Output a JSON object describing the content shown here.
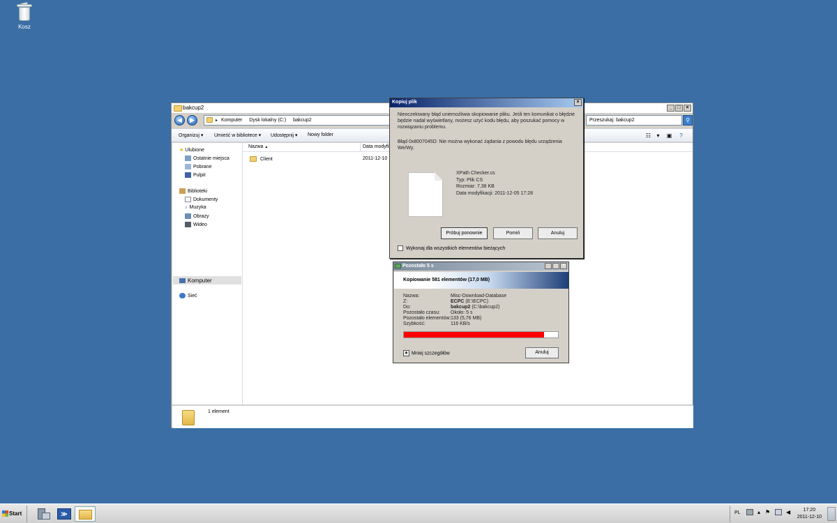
{
  "desktop": {
    "recycle_bin_label": "Kosz",
    "background_color": "#3a6ea5"
  },
  "explorer": {
    "title": "bakcup2",
    "breadcrumb": [
      "Komputer",
      "Dysk lokalny (C:)",
      "bakcup2"
    ],
    "search_placeholder": "Przeszukaj: bakcup2",
    "toolbar": {
      "organize": "Organizuj",
      "include_library": "Umieść w bibliotece",
      "share": "Udostępnij",
      "new_folder": "Nowy folder"
    },
    "nav": {
      "favorites": "Ulubione",
      "recent": "Ostatnie miejsca",
      "downloads": "Pobrane",
      "desktop": "Pulpit",
      "libraries": "Biblioteki",
      "documents": "Dokumenty",
      "music": "Muzyka",
      "pictures": "Obrazy",
      "videos": "Wideo",
      "computer": "Komputer",
      "network": "Sieć"
    },
    "columns": {
      "name": "Nazwa",
      "date": "Data modyfik"
    },
    "rows": [
      {
        "name": "Client",
        "date": "2011-12-10"
      }
    ],
    "status": "1 element"
  },
  "error_dialog": {
    "title": "Kopiuj plik",
    "message": "Nieoczekiwany błąd uniemożliwia skopiowanie pliku. Jeśli ten komunikat o błędzie będzie nadal wyświetlany, możesz użyć kodu błędu, aby poszukać pomocy w rozwiązaniu problemu.",
    "error_text": "Błąd 0x8007045D: Nie można wykonać żądania z powodu błędu urządzenia We/Wy.",
    "file": {
      "name": "XPath Checker.cs",
      "type": "Typ: Plik CS",
      "size": "Rozmiar: 7,38 KB",
      "modified": "Data modyfikacji: 2011-12-05 17:28"
    },
    "buttons": {
      "retry": "Próbuj ponownie",
      "skip": "Pomiń",
      "cancel": "Anuluj"
    },
    "checkbox_label": "Wykonaj dla wszystkich elementów bieżących",
    "checkbox_checked": false
  },
  "progress_dialog": {
    "title": "Pozostało 5 s",
    "header": "Kopiowanie 581 elementów (17,0 MB)",
    "labels": {
      "name": "Nazwa:",
      "from": "Z:",
      "to": "Do:",
      "time_left": "Pozostało czasu:",
      "items_left": "Pozostało elementów:",
      "speed": "Szybkość:"
    },
    "values": {
      "name": "Misc-Download-Database",
      "from_bold": "ECPC",
      "from_rest": " (E:\\ECPC)",
      "to_bold": "bakcup2",
      "to_rest": " (C:\\bakcup2)",
      "time_left": "Około: 5 s",
      "items_left": "133 (5,76 MB)",
      "speed": "116 KB/s"
    },
    "progress_fraction": 0.91,
    "progress_color": "#ff0000",
    "less_details": "Mniej szczegółów",
    "cancel": "Anuluj"
  },
  "taskbar": {
    "start_label": "Start",
    "language": "PL",
    "time": "17:20",
    "date": "2011-12-10"
  }
}
